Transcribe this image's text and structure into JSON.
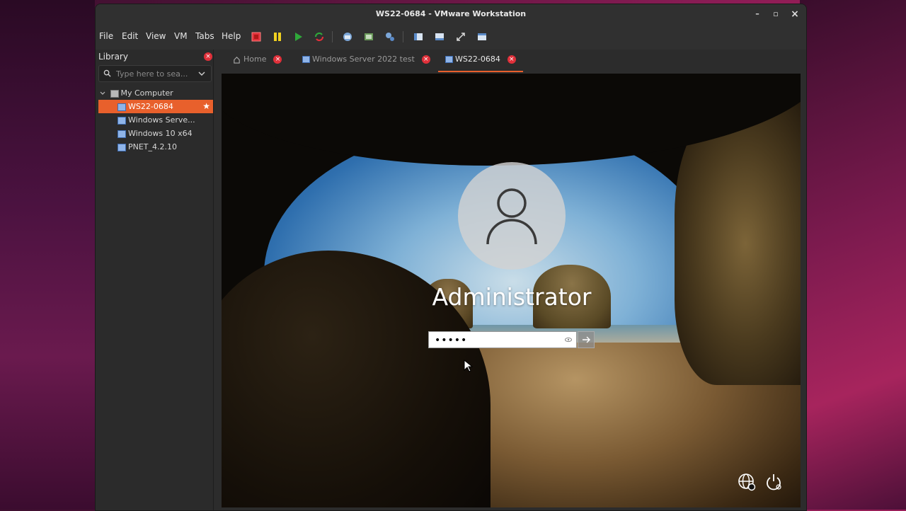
{
  "window": {
    "title": "WS22-0684 - VMware Workstation",
    "minimize": "–",
    "maximize": "▫",
    "close": "×"
  },
  "menubar": {
    "items": [
      "File",
      "Edit",
      "View",
      "VM",
      "Tabs",
      "Help"
    ]
  },
  "library": {
    "title": "Library",
    "close": "×",
    "search_placeholder": "Type here to sea...",
    "tree": {
      "root_label": "My Computer",
      "items": [
        {
          "label": "WS22-0684",
          "selected": true
        },
        {
          "label": "Windows Serve...",
          "selected": false
        },
        {
          "label": "Windows 10 x64",
          "selected": false
        },
        {
          "label": "PNET_4.2.10",
          "selected": false
        }
      ]
    }
  },
  "tabs": [
    {
      "label": "Home",
      "close": "×"
    },
    {
      "label": "Windows Server 2022 test",
      "close": "×"
    },
    {
      "label": "WS22-0684",
      "close": "×"
    }
  ],
  "login": {
    "username": "Administrator",
    "password_value": "•••••"
  },
  "colors": {
    "accent": "#e8602c",
    "close_red": "#e0303a"
  },
  "icons": {
    "power_off": "stop-square-icon",
    "suspend": "pause-icon",
    "power_on": "play-icon",
    "revert": "refresh-icon",
    "language": "globe-icon",
    "power_menu": "power-icon"
  }
}
